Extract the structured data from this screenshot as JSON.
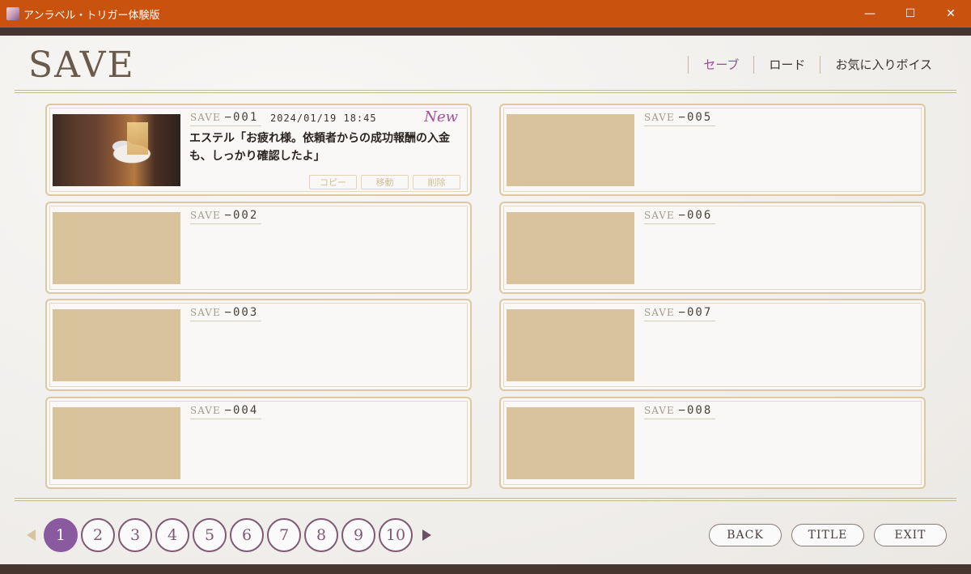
{
  "window": {
    "title": "アンラベル・トリガー体験版",
    "controls": {
      "minimize": "—",
      "maximize": "☐",
      "close": "✕"
    }
  },
  "header": {
    "title": "SAVE",
    "tabs": [
      {
        "label": "セーブ",
        "active": true
      },
      {
        "label": "ロード",
        "active": false
      },
      {
        "label": "お気に入りボイス",
        "active": false
      }
    ]
  },
  "slots": [
    {
      "label": "SAVE",
      "number": "−001",
      "date": "2024/01/19 18:45",
      "badge": "New",
      "text": "エステル「お疲れ様。依頼者からの成功報酬の入金も、しっかり確認したよ」",
      "actions": [
        "コピー",
        "移動",
        "削除"
      ]
    },
    {
      "label": "SAVE",
      "number": "−002"
    },
    {
      "label": "SAVE",
      "number": "−003"
    },
    {
      "label": "SAVE",
      "number": "−004"
    },
    {
      "label": "SAVE",
      "number": "−005"
    },
    {
      "label": "SAVE",
      "number": "−006"
    },
    {
      "label": "SAVE",
      "number": "−007"
    },
    {
      "label": "SAVE",
      "number": "−008"
    }
  ],
  "pager": {
    "pages": [
      "1",
      "2",
      "3",
      "4",
      "5",
      "6",
      "7",
      "8",
      "9",
      "10"
    ],
    "current_page": "1"
  },
  "footer": {
    "back": "BACK",
    "title": "TITLE",
    "exit": "EXIT"
  },
  "colors": {
    "titlebar": "#c9520f",
    "accent": "#9b4a94",
    "page_active": "#8a5aa0",
    "slot_border": "#dcc9a3",
    "thumb_empty": "#d8c39c"
  }
}
